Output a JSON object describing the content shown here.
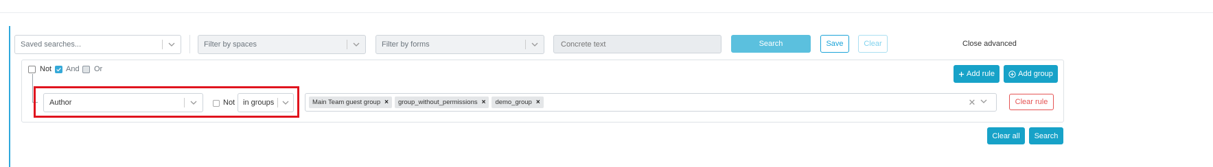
{
  "search_bar": {
    "saved_searches_placeholder": "Saved searches...",
    "spaces_placeholder": "Filter by spaces",
    "forms_placeholder": "Filter by forms",
    "concrete_text_placeholder": "Concrete text",
    "search_label": "Search",
    "save_label": "Save",
    "clear_label": "Clear",
    "close_advanced_label": "Close advanced"
  },
  "query_builder": {
    "group": {
      "not_label": "Not",
      "and_label": "And",
      "or_label": "Or",
      "not_checked": false,
      "and_checked": true,
      "or_checked": false,
      "add_rule_label": "Add rule",
      "add_group_label": "Add group"
    },
    "rule": {
      "field_value": "Author",
      "not_label": "Not",
      "not_checked": false,
      "operator_value": "in groups",
      "tags": [
        "Main Team guest group",
        "group_without_permissions",
        "demo_group"
      ],
      "clear_rule_label": "Clear rule"
    },
    "footer": {
      "clear_all_label": "Clear all",
      "search_label": "Search"
    }
  },
  "icons": {
    "chevron": "chevron-down-icon",
    "plus": "plus-icon",
    "plus_circle": "plus-circle-icon",
    "remove": "close-icon"
  },
  "colors": {
    "accent": "#17a2c8",
    "light_accent": "#5bc0de",
    "danger": "#e55353",
    "highlight": "#e0141e"
  }
}
